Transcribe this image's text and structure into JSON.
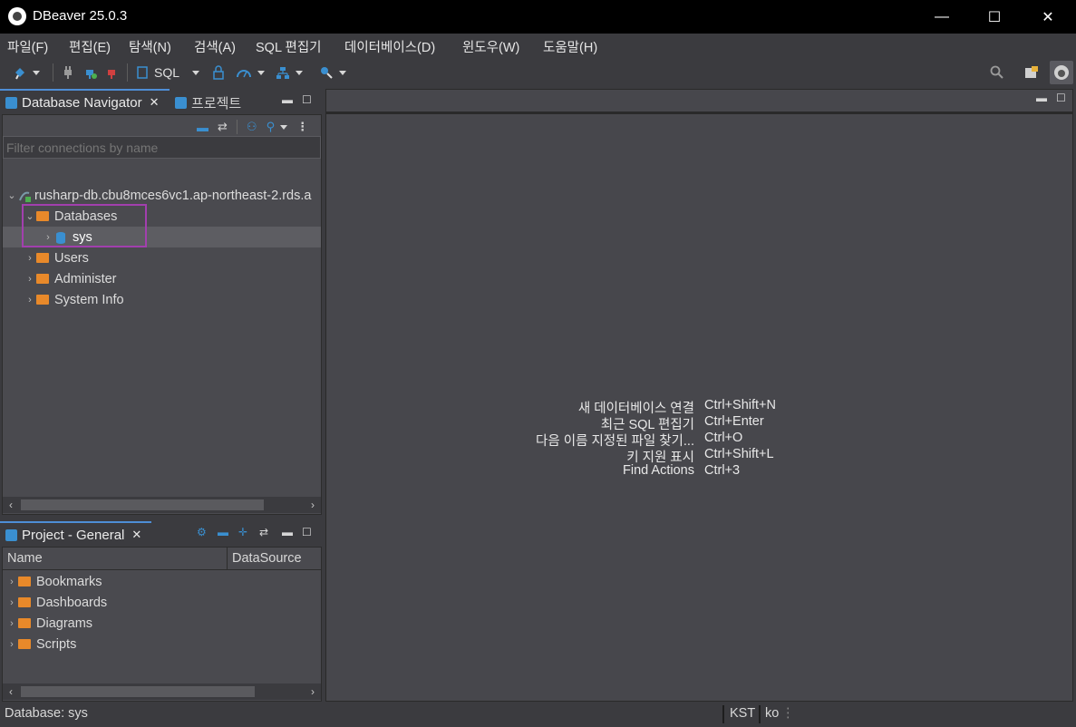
{
  "window": {
    "title": "DBeaver 25.0.3",
    "minimize": "—",
    "maximize": "☐",
    "close": "✕"
  },
  "menu": [
    "파일(F)",
    "편집(E)",
    "탐색(N)",
    "검색(A)",
    "SQL 편집기",
    "데이터베이스(D)",
    "윈도우(W)",
    "도움말(H)"
  ],
  "toolbar": {
    "sql_label": "SQL"
  },
  "navigator": {
    "tab_label": "Database Navigator",
    "tab2_label": "프로젝트",
    "filter_placeholder": "Filter connections by name",
    "connection": "rusharp-db.cbu8mces6vc1.ap-northeast-2.rds.a",
    "databases_label": "Databases",
    "sys_label": "sys",
    "users_label": "Users",
    "administer_label": "Administer",
    "sysinfo_label": "System Info"
  },
  "project": {
    "tab_label": "Project - General",
    "col_name": "Name",
    "col_datasource": "DataSource",
    "items": [
      "Bookmarks",
      "Dashboards",
      "Diagrams",
      "Scripts"
    ]
  },
  "editor": {
    "shortcuts": [
      {
        "name": "새 데이터베이스 연결",
        "key": "Ctrl+Shift+N"
      },
      {
        "name": "최근 SQL 편집기",
        "key": "Ctrl+Enter"
      },
      {
        "name": "다음 이름 지정된 파일 찾기...",
        "key": "Ctrl+O"
      },
      {
        "name": "키 지원 표시",
        "key": "Ctrl+Shift+L"
      },
      {
        "name": "Find Actions",
        "key": "Ctrl+3"
      }
    ]
  },
  "status": {
    "left": "Database: sys",
    "timezone": "KST",
    "locale": "ko"
  },
  "colors": {
    "accent": "#4e8ed6",
    "highlight_box": "#a23fae",
    "folder": "#e8892a"
  }
}
